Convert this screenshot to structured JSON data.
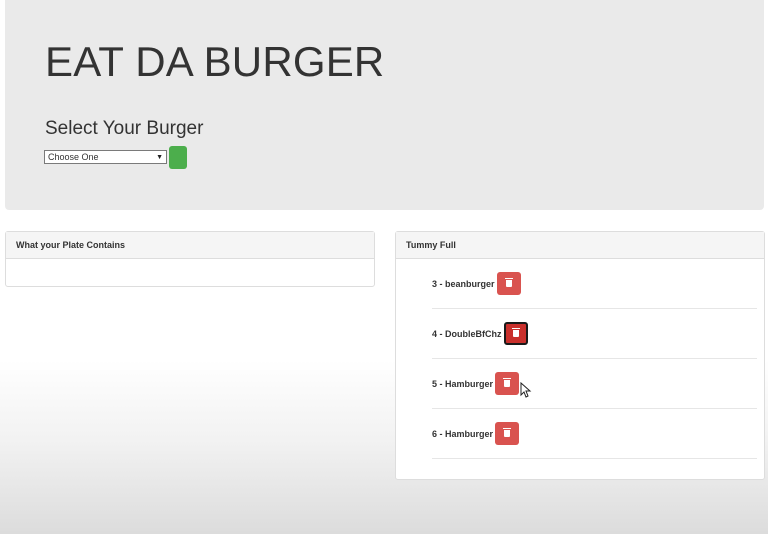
{
  "header": {
    "title": "EAT DA BURGER",
    "select_heading": "Select Your Burger",
    "select_value": "Choose One"
  },
  "plate_panel": {
    "title": "What your Plate Contains"
  },
  "tummy_panel": {
    "title": "Tummy Full",
    "items": [
      {
        "label": "3 - beanburger"
      },
      {
        "label": "4 - DoubleBfChz"
      },
      {
        "label": "5 - Hamburger"
      },
      {
        "label": "6 - Hamburger"
      }
    ]
  },
  "icons": {
    "delete": "trash-icon",
    "dropdown": "chevron-down-icon",
    "pointer": "mouse-pointer-icon"
  },
  "colors": {
    "jumbotron_bg": "#eaeaea",
    "go_button": "#4cae4c",
    "delete_button": "#d9534f"
  }
}
